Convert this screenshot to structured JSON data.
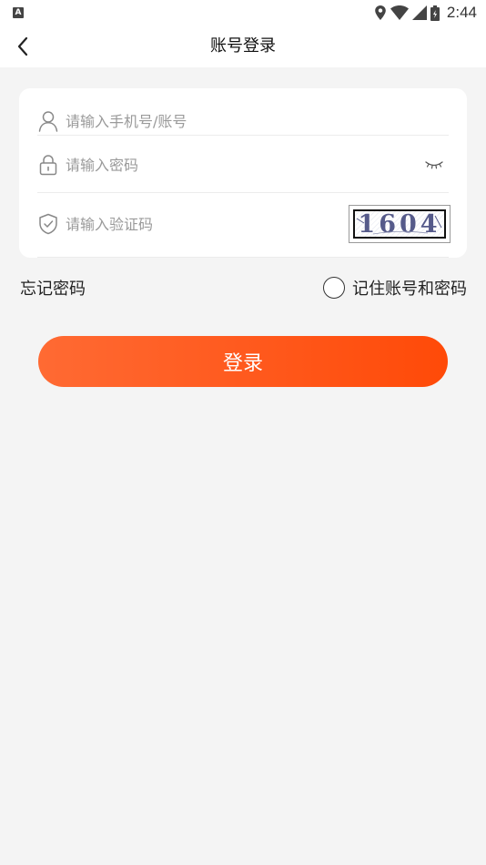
{
  "status_bar": {
    "left_badge": "A",
    "time": "2:44",
    "icons": [
      "location-icon",
      "wifi-icon",
      "signal-icon",
      "battery-icon"
    ]
  },
  "nav": {
    "title": "账号登录",
    "back_icon": "chevron-left-icon"
  },
  "form": {
    "phone_placeholder": "请输入手机号/账号",
    "phone_value": "",
    "password_placeholder": "请输入密码",
    "password_value": "",
    "code_placeholder": "请输入验证码",
    "code_value": "",
    "captcha_text": "1604"
  },
  "options": {
    "forgot_label": "忘记密码",
    "remember_label": "记住账号和密码",
    "remember_checked": false
  },
  "login_button_label": "登录",
  "colors": {
    "accent_start": "#ff6a33",
    "accent_end": "#ff4a08",
    "background": "#f4f4f4",
    "card": "#ffffff",
    "placeholder": "#9a9a9a"
  }
}
